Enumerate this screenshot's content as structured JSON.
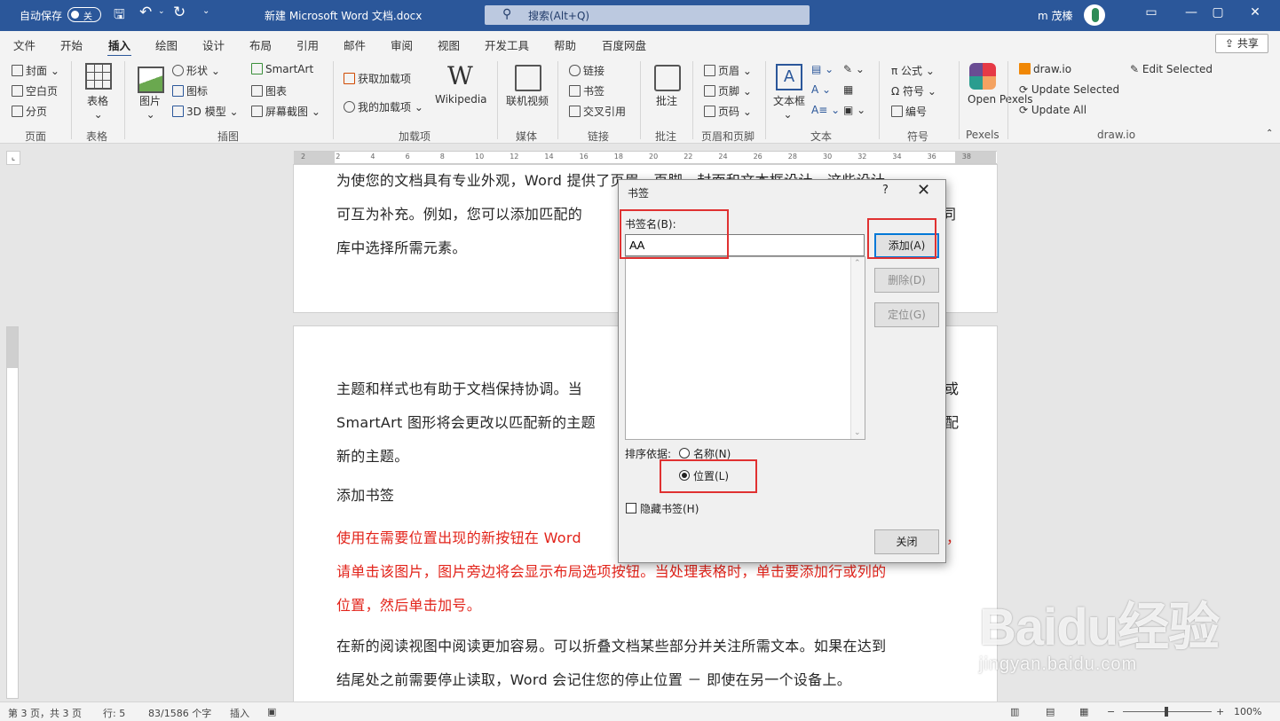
{
  "titlebar": {
    "autosave_label": "自动保存",
    "autosave_state": "关",
    "doc_title": "新建 Microsoft Word 文档.docx",
    "search_placeholder": "搜索(Alt+Q)",
    "user": "m 茂榛"
  },
  "tabs": [
    "文件",
    "开始",
    "插入",
    "绘图",
    "设计",
    "布局",
    "引用",
    "邮件",
    "审阅",
    "视图",
    "开发工具",
    "帮助",
    "百度网盘"
  ],
  "active_tab": "插入",
  "share_label": "共享",
  "ribbon": {
    "pages": {
      "items": [
        "封面",
        "空白页",
        "分页"
      ],
      "label": "页面"
    },
    "tables": {
      "item": "表格",
      "label": "表格"
    },
    "illustrations": {
      "picture": "图片",
      "shapes": "形状",
      "icons": "图标",
      "model3d": "3D 模型",
      "smartart": "SmartArt",
      "chart": "图表",
      "screenshot": "屏幕截图",
      "label": "插图"
    },
    "addins": {
      "get": "获取加载项",
      "my": "我的加载项",
      "wikipedia": "Wikipedia",
      "label": "加载项"
    },
    "media": {
      "video": "联机视频",
      "label": "媒体"
    },
    "links": {
      "link": "链接",
      "bookmark": "书签",
      "crossref": "交叉引用",
      "label": "链接"
    },
    "comments": {
      "comment": "批注",
      "label": "批注"
    },
    "headerfooter": {
      "header": "页眉",
      "footer": "页脚",
      "pagenum": "页码",
      "label": "页眉和页脚"
    },
    "text": {
      "textbox": "文本框",
      "label": "文本"
    },
    "symbols": {
      "equation": "公式",
      "symbol": "符号",
      "number": "编号",
      "label": "符号"
    },
    "pexels": {
      "open": "Open Pexels",
      "label": "Pexels"
    },
    "drawio": {
      "drawio": "draw.io",
      "update_selected": "Update Selected",
      "update_all": "Update All",
      "edit_selected": "Edit Selected",
      "label": "draw.io"
    }
  },
  "ruler_numbers": [
    "2",
    "2",
    "4",
    "6",
    "8",
    "10",
    "12",
    "14",
    "16",
    "18",
    "20",
    "22",
    "24",
    "26",
    "28",
    "30",
    "32",
    "34",
    "36",
    "38"
  ],
  "document": {
    "p1": [
      "为使您的文档具有专业外观，Word 提供了页眉、页脚、封面和文本框设计，这些设计",
      "可互为补充。例如，您可以添加匹配的",
      "库中选择所需元素。"
    ],
    "p1_right": "同",
    "p2": [
      "主题和样式也有助于文档保持协调。当",
      "SmartArt  图形将会更改以匹配新的主题",
      "新的主题。"
    ],
    "p2_right": [
      "或",
      "配"
    ],
    "heading": "添加书签",
    "p3_red": [
      "使用在需要位置出现的新按钮在  Word",
      "请单击该图片，图片旁边将会显示布局选项按钮。当处理表格时，单击要添加行或列的",
      "位置，然后单击加号。"
    ],
    "p3_right": "，",
    "p4": [
      "在新的阅读视图中阅读更加容易。可以折叠文档某些部分并关注所需文本。如果在达到",
      "结尾处之前需要停止读取，Word  会记住您的停止位置 － 即使在另一个设备上。"
    ]
  },
  "dialog": {
    "title": "书签",
    "help": "?",
    "close_x": "✕",
    "name_label": "书签名(B):",
    "name_value": "AA",
    "add": "添加(A)",
    "delete": "删除(D)",
    "goto": "定位(G)",
    "sort_label": "排序依据:",
    "sort_name": "名称(N)",
    "sort_position": "位置(L)",
    "sort_selected": "position",
    "hidden": "隐藏书签(H)",
    "close": "关闭"
  },
  "status": {
    "page": "第 3 页，共 3 页",
    "line": "行: 5",
    "words": "83/1586 个字",
    "mode": "插入",
    "zoom": "100%"
  },
  "watermark": {
    "brand": "Baidu经验",
    "url": "jingyan.baidu.com"
  }
}
